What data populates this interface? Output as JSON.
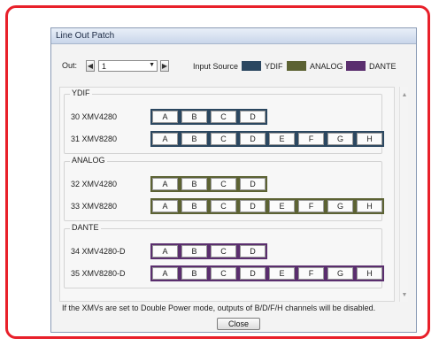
{
  "window": {
    "title": "Line Out Patch"
  },
  "out": {
    "label": "Out:",
    "value": "1",
    "prev_icon": "chevron-left-icon",
    "next_icon": "chevron-right-icon"
  },
  "legend": {
    "label": "Input Source",
    "items": [
      {
        "name": "YDIF",
        "color": "#2b4760"
      },
      {
        "name": "ANALOG",
        "color": "#5c6233"
      },
      {
        "name": "DANTE",
        "color": "#5a2e6e"
      }
    ]
  },
  "sections": [
    {
      "title": "YDIF",
      "color": "#2b4760",
      "rows": [
        {
          "label": "30 XMV4280",
          "channels": [
            "A",
            "B",
            "C",
            "D"
          ]
        },
        {
          "label": "31 XMV8280",
          "channels": [
            "A",
            "B",
            "C",
            "D",
            "E",
            "F",
            "G",
            "H"
          ]
        }
      ]
    },
    {
      "title": "ANALOG",
      "color": "#5c6233",
      "rows": [
        {
          "label": "32 XMV4280",
          "channels": [
            "A",
            "B",
            "C",
            "D"
          ]
        },
        {
          "label": "33 XMV8280",
          "channels": [
            "A",
            "B",
            "C",
            "D",
            "E",
            "F",
            "G",
            "H"
          ]
        }
      ]
    },
    {
      "title": "DANTE",
      "color": "#5a2e6e",
      "rows": [
        {
          "label": "34 XMV4280-D",
          "channels": [
            "A",
            "B",
            "C",
            "D"
          ]
        },
        {
          "label": "35 XMV8280-D",
          "channels": [
            "A",
            "B",
            "C",
            "D",
            "E",
            "F",
            "G",
            "H"
          ]
        }
      ]
    }
  ],
  "footer": {
    "note": "If the XMVs are set to Double Power mode, outputs of  B/D/F/H channels will be disabled.",
    "close_label": "Close"
  }
}
